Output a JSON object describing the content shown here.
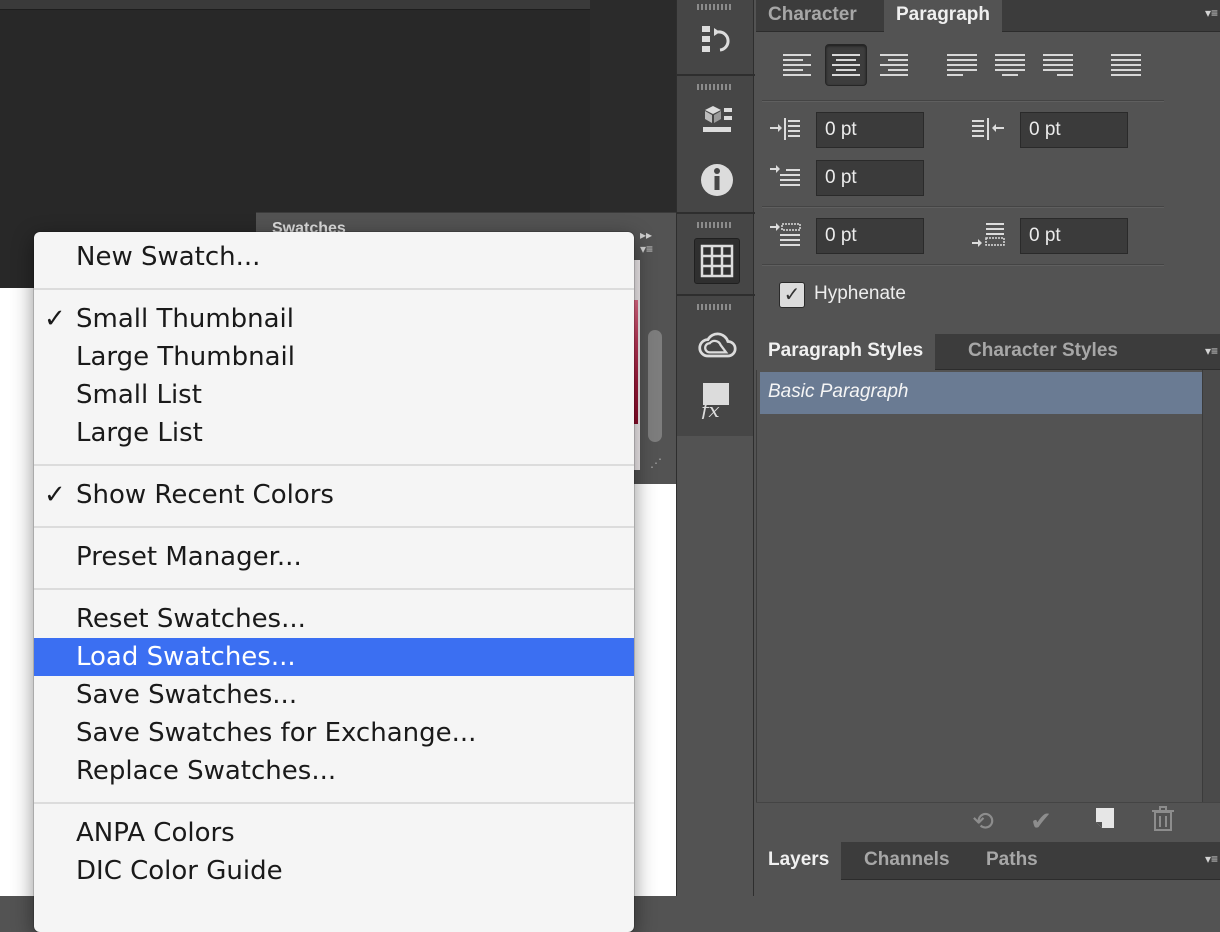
{
  "paragraph_panel": {
    "tabs": [
      "Character",
      "Paragraph"
    ],
    "active_tab": "Paragraph",
    "alignment_buttons": [
      "align-left",
      "align-center",
      "align-right",
      "justify-last-left",
      "justify-last-center",
      "justify-last-right",
      "justify-all"
    ],
    "selected_alignment": "align-center",
    "left_indent": "0 pt",
    "right_indent": "0 pt",
    "first_line_indent": "0 pt",
    "space_before": "0 pt",
    "space_after": "0 pt",
    "hyphenate_label": "Hyphenate",
    "hyphenate_checked": true,
    "checkmark": "✓"
  },
  "paragraph_styles_panel": {
    "tabs": [
      "Paragraph Styles",
      "Character Styles"
    ],
    "active_tab": "Paragraph Styles",
    "items": [
      "Basic Paragraph"
    ],
    "selected_color": "#6a7b93"
  },
  "layers_panel": {
    "tabs": [
      "Layers",
      "Channels",
      "Paths"
    ],
    "active_tab": "Layers"
  },
  "swatches_panel": {
    "tab": "Swatches"
  },
  "dock_icons": [
    "history-icon",
    "3d-icon",
    "info-icon",
    "swatches-grid-icon",
    "creative-cloud-icon",
    "styles-fx-icon"
  ],
  "dock_fx_glyph": "fx",
  "context_menu": {
    "highlight_color": "#3b6ff2",
    "checkmark": "✓",
    "groups": [
      [
        {
          "label": "New Swatch..."
        }
      ],
      [
        {
          "label": "Small Thumbnail",
          "checked": true
        },
        {
          "label": "Large Thumbnail"
        },
        {
          "label": "Small List"
        },
        {
          "label": "Large List"
        }
      ],
      [
        {
          "label": "Show Recent Colors",
          "checked": true
        }
      ],
      [
        {
          "label": "Preset Manager..."
        }
      ],
      [
        {
          "label": "Reset Swatches..."
        },
        {
          "label": "Load Swatches...",
          "highlighted": true
        },
        {
          "label": "Save Swatches..."
        },
        {
          "label": "Save Swatches for Exchange..."
        },
        {
          "label": "Replace Swatches..."
        }
      ],
      [
        {
          "label": "ANPA Colors"
        },
        {
          "label": "DIC Color Guide"
        }
      ]
    ]
  }
}
